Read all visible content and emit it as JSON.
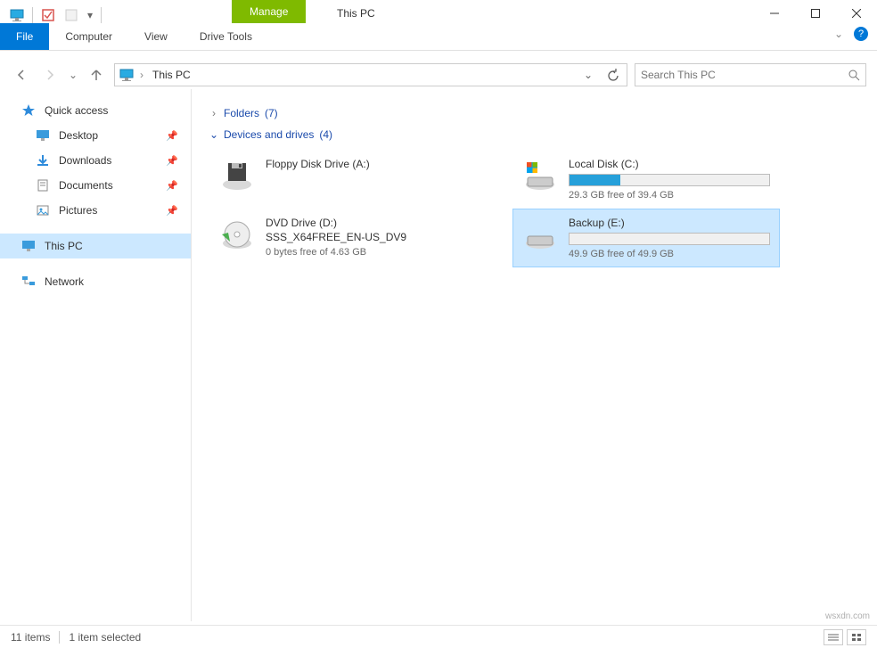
{
  "window": {
    "title": "This PC",
    "manage_tab": "Manage"
  },
  "ribbon": {
    "file": "File",
    "computer": "Computer",
    "view": "View",
    "drive_tools": "Drive Tools"
  },
  "nav": {
    "breadcrumb": "This PC",
    "search_placeholder": "Search This PC"
  },
  "sidebar": {
    "quick_access": "Quick access",
    "items": [
      {
        "label": "Desktop",
        "pinned": true
      },
      {
        "label": "Downloads",
        "pinned": true
      },
      {
        "label": "Documents",
        "pinned": true
      },
      {
        "label": "Pictures",
        "pinned": true
      }
    ],
    "this_pc": "This PC",
    "network": "Network"
  },
  "sections": {
    "folders": {
      "label": "Folders",
      "count": "(7)"
    },
    "drives": {
      "label": "Devices and drives",
      "count": "(4)"
    }
  },
  "drives": [
    {
      "name": "Floppy Disk Drive (A:)",
      "type": "floppy",
      "sub": "",
      "free": "",
      "bar": null
    },
    {
      "name": "Local Disk (C:)",
      "type": "local-win",
      "sub": "",
      "free": "29.3 GB free of 39.4 GB",
      "bar": 0.256,
      "selected": false
    },
    {
      "name": "DVD Drive (D:)",
      "type": "dvd",
      "sub": "SSS_X64FREE_EN-US_DV9",
      "free": "0 bytes free of 4.63 GB",
      "bar": null
    },
    {
      "name": "Backup (E:)",
      "type": "local",
      "sub": "",
      "free": "49.9 GB free of 49.9 GB",
      "bar": 0.0,
      "selected": true
    }
  ],
  "status": {
    "count": "11 items",
    "selected": "1 item selected"
  },
  "watermark": "wsxdn.com"
}
